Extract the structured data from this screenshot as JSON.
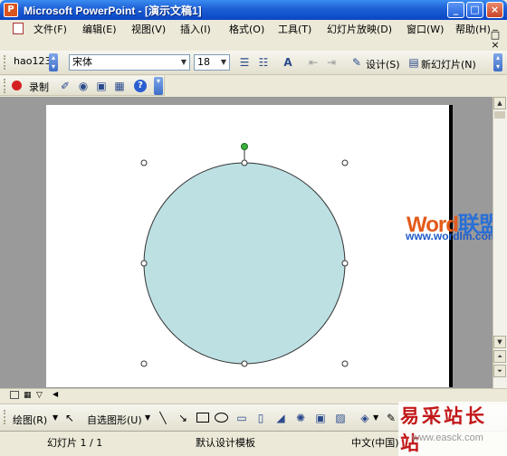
{
  "window": {
    "app_icon": "powerpoint-icon",
    "title": "Microsoft PowerPoint - [演示文稿1]",
    "minimize": "_",
    "maximize": "□",
    "close": "×"
  },
  "menu": {
    "items": [
      "文件(F)",
      "编辑(E)",
      "视图(V)",
      "插入(I)",
      "格式(O)",
      "工具(T)",
      "幻灯片放映(D)",
      "窗口(W)",
      "帮助(H)"
    ],
    "doc_controls": [
      "_",
      "□",
      "×"
    ]
  },
  "format_toolbar": {
    "style_value": "hao123",
    "font_value": "宋体",
    "size_value": "18",
    "design_label": "设计(S)",
    "new_slide_label": "新幻灯片(N)"
  },
  "record_toolbar": {
    "record_label": "录制"
  },
  "watermarks": {
    "brand_word": "Word",
    "brand_cn": "联盟",
    "brand_url": "www.wordlm.com",
    "site_cn": "易采站长站",
    "site_url": "www.easck.com"
  },
  "drawing_toolbar": {
    "draw_label": "绘图(R)",
    "autoshapes_label": "自选图形(U)"
  },
  "status": {
    "slide_info": "幻灯片  1 / 1",
    "template": "默认设计模板",
    "language": "中文(中国)"
  },
  "colors": {
    "circle_fill": "#bde0e3",
    "rotate_handle": "#3cb13c",
    "title_bar": "#0a46c4"
  }
}
